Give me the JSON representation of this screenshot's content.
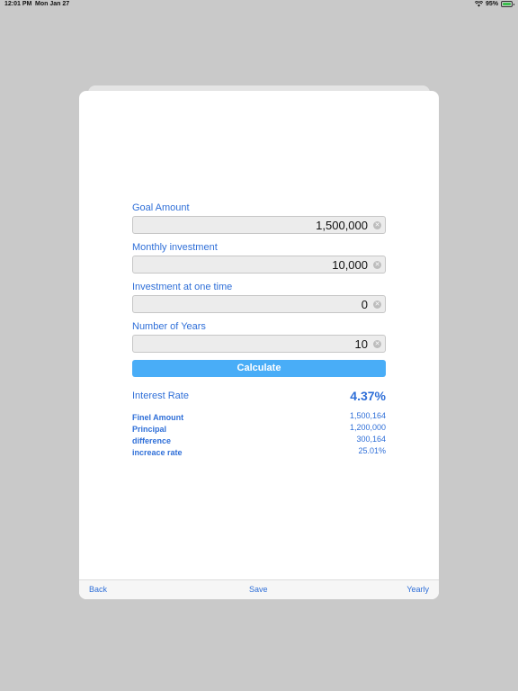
{
  "status": {
    "time": "12:01 PM",
    "date": "Mon Jan 27",
    "battery": "95%"
  },
  "form": {
    "goal_label": "Goal Amount",
    "goal_value": "1,500,000",
    "monthly_label": "Monthly investment",
    "monthly_value": "10,000",
    "onetime_label": "Investment at one time",
    "onetime_value": "0",
    "years_label": "Number of Years",
    "years_value": "10",
    "calculate_label": "Calculate"
  },
  "results": {
    "interest_label": "Interest Rate",
    "interest_value": "4.37%",
    "rows": [
      {
        "label": "Finel Amount",
        "value": "1,500,164"
      },
      {
        "label": "Principal",
        "value": "1,200,000"
      },
      {
        "label": "difference",
        "value": "300,164"
      },
      {
        "label": "increace rate",
        "value": "25.01%"
      }
    ]
  },
  "toolbar": {
    "back": "Back",
    "save": "Save",
    "yearly": "Yearly"
  },
  "colors": {
    "accent": "#2f6fd8",
    "button": "#49adf7",
    "background": "#c9c9c9"
  }
}
